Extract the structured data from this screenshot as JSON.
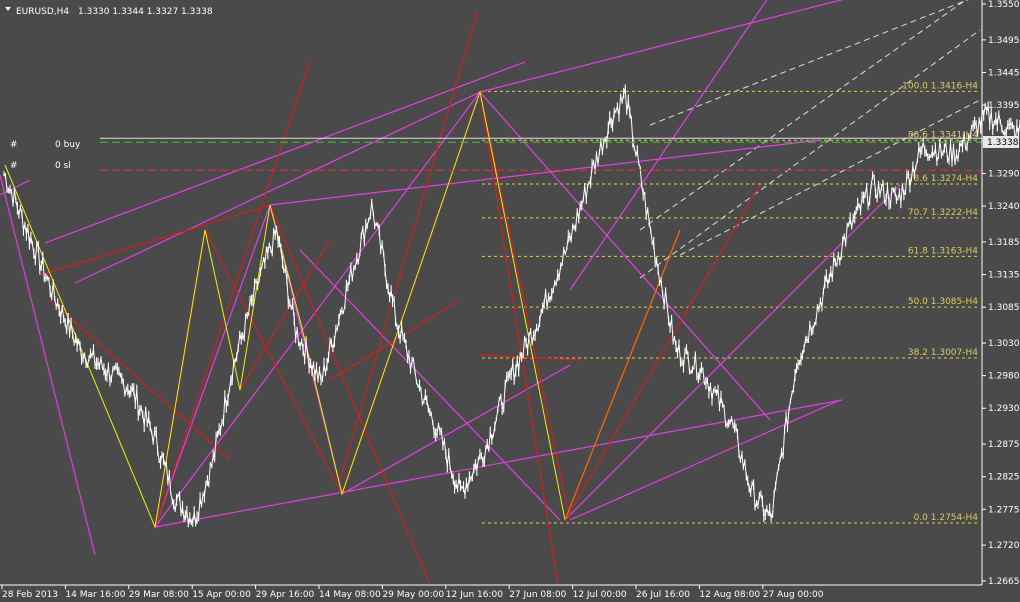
{
  "header": {
    "symbol": "EURUSD,H4",
    "ohlc": "1.3330 1.3344 1.3327 1.3338"
  },
  "orders": {
    "buy": {
      "marker": "#",
      "label": "0 buy"
    },
    "sl": {
      "marker": "#",
      "label": "0 sl"
    }
  },
  "colors": {
    "background": "#4a4a4a",
    "candles": "#ffffff",
    "fib_text": "#d8cc60",
    "magenta": "#e040e0",
    "red": "#d02020",
    "yellow": "#f0f000",
    "orange": "#ff6a00",
    "channel": "#dddddd",
    "axis_text": "#ffffff"
  },
  "chart_data": {
    "type": "line",
    "instrument": "EURUSD",
    "timeframe": "H4",
    "current_price": "1.3338",
    "y_ticks": [
      "1.3550",
      "1.3495",
      "1.3445",
      "1.3395",
      "1.3340",
      "1.3290",
      "1.3240",
      "1.3185",
      "1.3135",
      "1.3085",
      "1.3030",
      "1.2980",
      "1.2930",
      "1.2875",
      "1.2825",
      "1.2775",
      "1.2720",
      "1.2665"
    ],
    "ylim": [
      1.2665,
      1.355
    ],
    "x_labels": [
      "28 Feb 2013",
      "14 Mar 16:00",
      "29 Mar 08:00",
      "15 Apr 00:00",
      "29 Apr 16:00",
      "14 May 08:00",
      "29 May 00:00",
      "12 Jun 16:00",
      "27 Jun 08:00",
      "12 Jul 00:00",
      "26 Jul 16:00",
      "12 Aug 08:00",
      "27 Aug 00:00"
    ],
    "price_path": [
      [
        0,
        1.329
      ],
      [
        0.8,
        1.31
      ],
      [
        1.2,
        1.302
      ],
      [
        2,
        1.296
      ],
      [
        2.4,
        1.288
      ],
      [
        2.7,
        1.279
      ],
      [
        3,
        1.276
      ],
      [
        3.3,
        1.285
      ],
      [
        3.6,
        1.299
      ],
      [
        4,
        1.312
      ],
      [
        4.3,
        1.32
      ],
      [
        4.6,
        1.305
      ],
      [
        5,
        1.297
      ],
      [
        5.4,
        1.311
      ],
      [
        5.8,
        1.324
      ],
      [
        6.2,
        1.306
      ],
      [
        6.6,
        1.295
      ],
      [
        6.9,
        1.288
      ],
      [
        7.2,
        1.28
      ],
      [
        7.6,
        1.287
      ],
      [
        8,
        1.298
      ],
      [
        8.4,
        1.306
      ],
      [
        8.9,
        1.318
      ],
      [
        9.3,
        1.33
      ],
      [
        9.6,
        1.338
      ],
      [
        9.8,
        1.341
      ],
      [
        10.2,
        1.32
      ],
      [
        10.6,
        1.302
      ],
      [
        11,
        1.299
      ],
      [
        11.5,
        1.29
      ],
      [
        11.8,
        1.28
      ],
      [
        12.1,
        1.276
      ],
      [
        12.5,
        1.3
      ],
      [
        12.9,
        1.31
      ],
      [
        13.3,
        1.32
      ],
      [
        13.7,
        1.327
      ],
      [
        14.1,
        1.325
      ],
      [
        14.5,
        1.333
      ],
      [
        15,
        1.332
      ],
      [
        15.5,
        1.338
      ],
      [
        16,
        1.335
      ],
      [
        16.4,
        1.3445
      ],
      [
        16.8,
        1.34
      ],
      [
        17.2,
        1.3338
      ]
    ],
    "fib_levels": [
      {
        "pct": "100.0",
        "price": "1.3416",
        "label": "100.0  1.3416-H4"
      },
      {
        "pct": "88.6",
        "price": "1.3341",
        "label": "88.6  1.3341-H4"
      },
      {
        "pct": "78.6",
        "price": "1.3274",
        "label": "78.6  1.3274-H4"
      },
      {
        "pct": "70.7",
        "price": "1.3222",
        "label": "70.7  1.3222-H4"
      },
      {
        "pct": "61.8",
        "price": "1.3163",
        "label": "61.8  1.3163-H4"
      },
      {
        "pct": "50.0",
        "price": "1.3085",
        "label": "50.0  1.3085-H4"
      },
      {
        "pct": "38.2",
        "price": "1.3007",
        "label": "38.2  1.3007-H4"
      },
      {
        "pct": "0.0",
        "price": "1.2754",
        "label": "0.0  1.2754-H4"
      }
    ],
    "order_levels": [
      {
        "name": "buy",
        "price": 1.3338
      },
      {
        "name": "sl",
        "price": 1.3295
      }
    ],
    "grid": false
  }
}
